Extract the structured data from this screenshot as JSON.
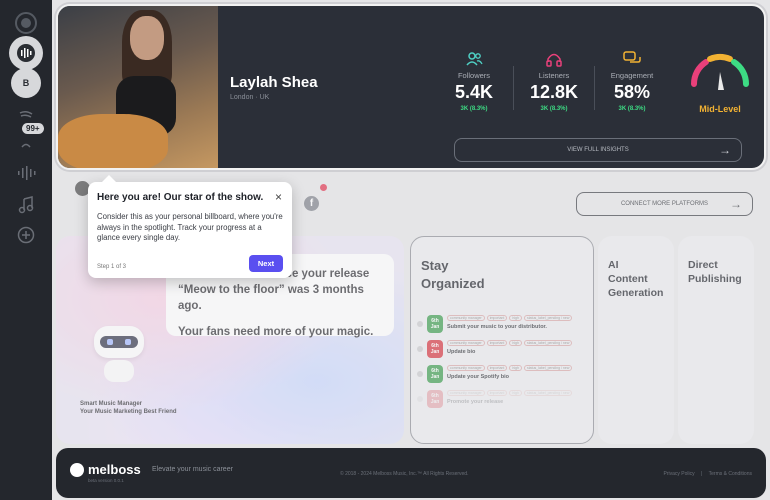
{
  "sidebar": {
    "items": [
      {
        "icon": "home-icon"
      },
      {
        "icon": "waveform-icon"
      },
      {
        "label": "B"
      },
      {
        "icon": "spotify-icon",
        "badge": "99+"
      },
      {
        "icon": "equalizer-icon"
      },
      {
        "icon": "music-note-icon"
      },
      {
        "icon": "add-icon"
      }
    ]
  },
  "profile": {
    "name": "Laylah Shea",
    "location": "London · UK"
  },
  "stats": [
    {
      "label": "Followers",
      "value": "5.4K",
      "change": "3K (8.3%)",
      "icon": "users-icon",
      "color": "#4fd1c5"
    },
    {
      "label": "Listeners",
      "value": "12.8K",
      "change": "3K (8.3%)",
      "icon": "headphones-icon",
      "color": "#e9407a"
    },
    {
      "label": "Engagement",
      "value": "58%",
      "change": "3K (8.3%)",
      "icon": "chat-icon",
      "color": "#f2b233"
    }
  ],
  "gauge": {
    "label": "Mid-Level",
    "level": 0.55
  },
  "insights_button": "VIEW FULL INSIGHTS",
  "connect_button": "CONNECT MORE PLATFORMS",
  "manager": {
    "line1": "It's been a while since your release “Meow to the floor” was 3 months ago.",
    "line2": "Your fans need more of your magic.",
    "caption1": "Smart Music Manager",
    "caption2": "Your Music Marketing Best Friend"
  },
  "stay": {
    "title_line1": "Stay",
    "title_line2": "Organized",
    "tasks": [
      {
        "date": "6th Jan",
        "color": "#3a9b4c",
        "title": "Submit your music to your distributor.",
        "tags": [
          "community manager",
          "important",
          "high",
          "status_label_pending / new"
        ]
      },
      {
        "date": "6th Jan",
        "color": "#d6323c",
        "title": "Update bio",
        "tags": [
          "community manager",
          "important",
          "high",
          "status_label_pending / new"
        ]
      },
      {
        "date": "6th Jan",
        "color": "#3a9b4c",
        "title": "Update your Spotify bio",
        "tags": [
          "community manager",
          "important",
          "high",
          "status_label_pending / new"
        ]
      },
      {
        "date": "6th Jan",
        "color": "#d6323c",
        "title": "Promote your release",
        "tags": [
          "community manager",
          "important",
          "high",
          "status_label_pending / new"
        ]
      }
    ]
  },
  "cards": {
    "ai": {
      "line1": "AI",
      "line2": "Content",
      "line3": "Generation"
    },
    "direct": {
      "line1": "Direct",
      "line2": "Publishing"
    }
  },
  "footer": {
    "brand": "melboss",
    "version": "beta version 0.0.1",
    "tagline": "Elevate your music career",
    "copyright": "© 2018 - 2024 Melboss Music, Inc.™ All Rights Reserved.",
    "privacy": "Privacy Policy",
    "terms": "Terms & Conditions"
  },
  "tooltip": {
    "title": "Here you are! Our star of the show.",
    "body": "Consider this as your personal billboard, where you're always in the spotlight. Track your progress at a glance every single day.",
    "step": "Step 1 of 3",
    "next": "Next",
    "close": "×"
  }
}
